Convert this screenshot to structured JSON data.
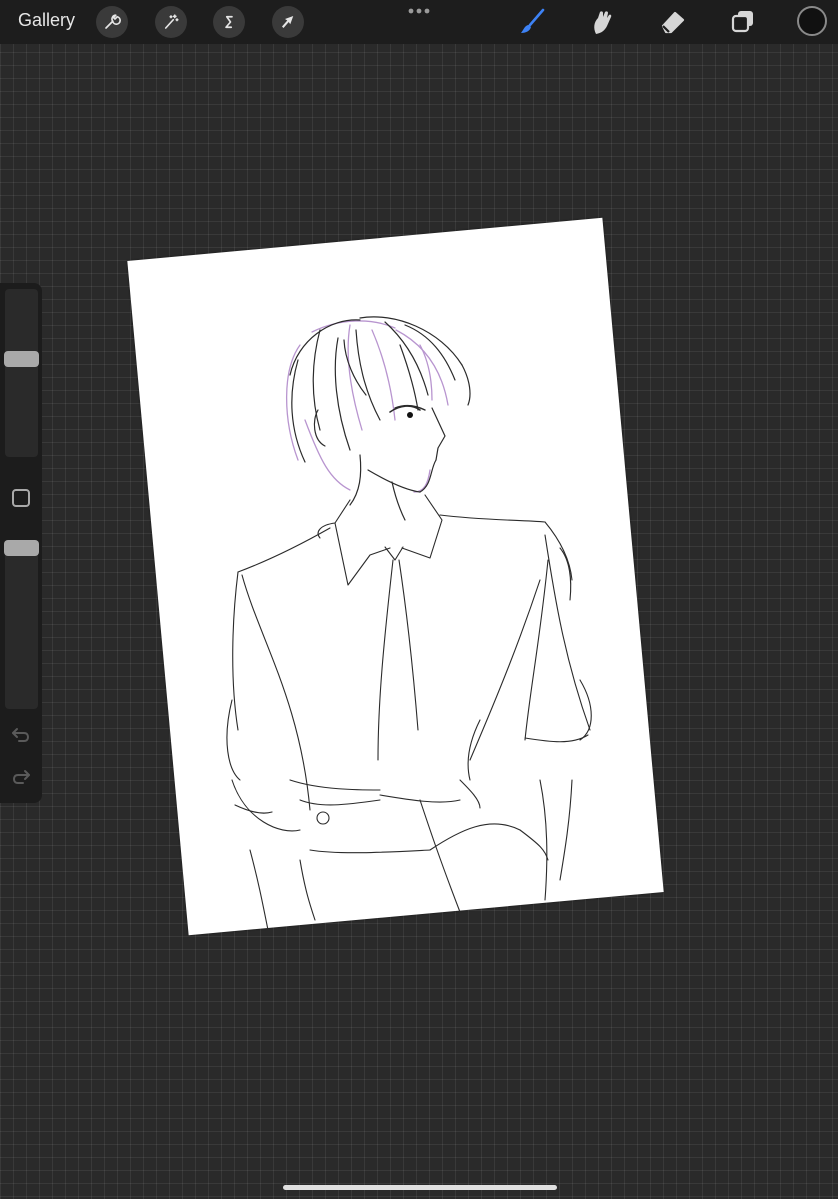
{
  "toolbar": {
    "gallery_label": "Gallery",
    "left_tools": [
      "wrench-icon",
      "magic-wand-icon",
      "selection-icon",
      "transform-arrow-icon"
    ],
    "more_menu": "more-dots-icon",
    "right_tools": [
      "brush-icon",
      "smudge-icon",
      "eraser-icon",
      "layers-icon"
    ],
    "active_tool": "brush",
    "active_tool_color": "#3d82f5",
    "current_color": "#111111"
  },
  "sidebar": {
    "brush_size_level": 0.72,
    "opacity_level": 0.96,
    "modify_button": "square-icon",
    "undo": "undo-icon",
    "redo": "redo-icon"
  },
  "canvas": {
    "background": "#ffffff",
    "sketch_colors": [
      "#2b2b2b",
      "#a77bc4"
    ]
  }
}
